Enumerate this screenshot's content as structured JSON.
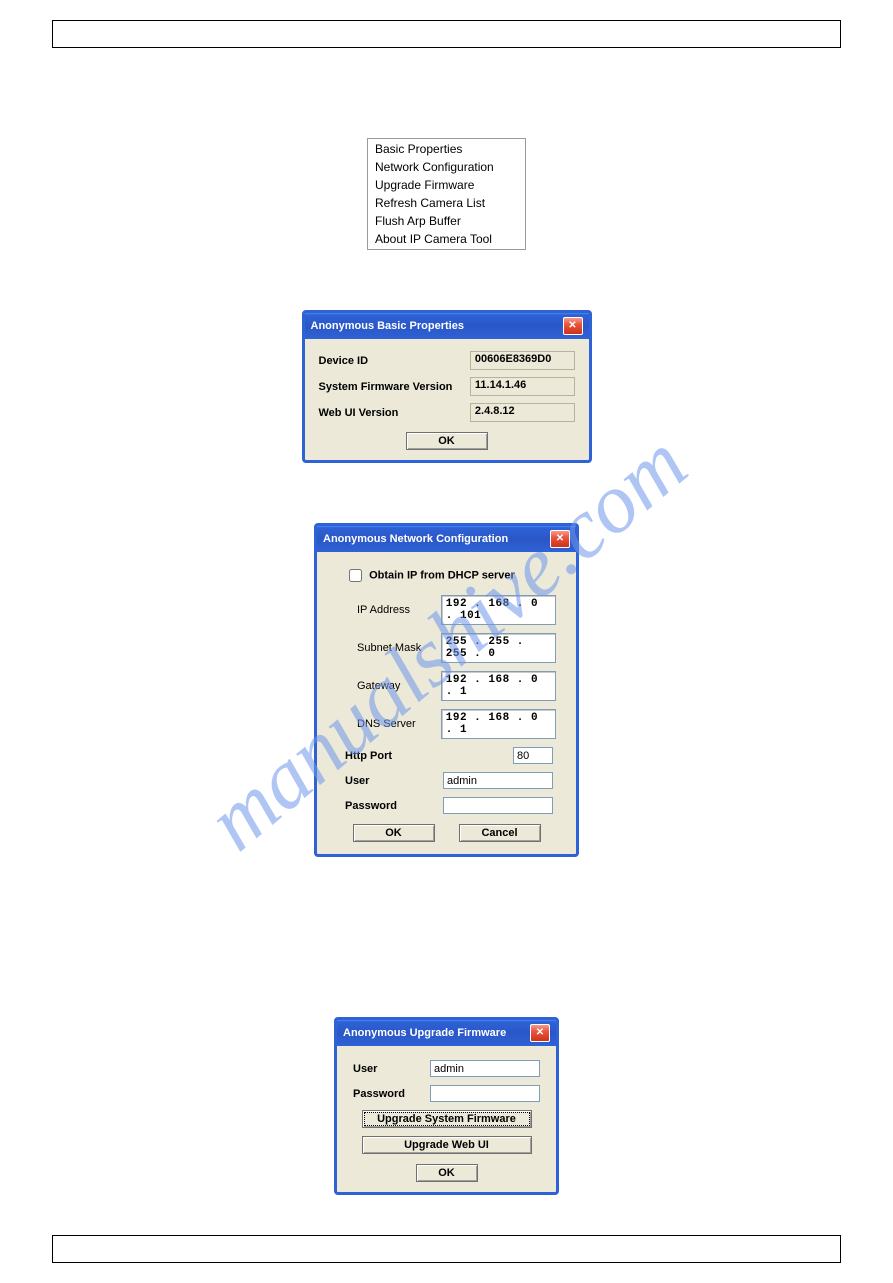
{
  "watermark": "manualshive.com",
  "context_menu": {
    "items": [
      "Basic Properties",
      "Network Configuration",
      "Upgrade Firmware",
      "Refresh Camera List",
      "Flush Arp Buffer",
      "About IP Camera Tool"
    ]
  },
  "dialog_basic": {
    "title": "Anonymous Basic Properties",
    "fields": {
      "device_id": {
        "label": "Device ID",
        "value": "00606E8369D0"
      },
      "firmware": {
        "label": "System Firmware Version",
        "value": "11.14.1.46"
      },
      "webui": {
        "label": "Web UI Version",
        "value": "2.4.8.12"
      }
    },
    "ok": "OK"
  },
  "dialog_network": {
    "title": "Anonymous Network Configuration",
    "dhcp_label": "Obtain IP from DHCP server",
    "dhcp_checked": false,
    "fields": {
      "ip": {
        "label": "IP Address",
        "value": "192 . 168 .  0  . 101"
      },
      "subnet": {
        "label": "Subnet Mask",
        "value": "255 . 255 . 255 .  0"
      },
      "gateway": {
        "label": "Gateway",
        "value": "192 . 168 .  0  .  1"
      },
      "dns": {
        "label": "DNS Server",
        "value": "192 . 168 .  0  .  1"
      }
    },
    "http_port": {
      "label": "Http Port",
      "value": "80"
    },
    "user": {
      "label": "User",
      "value": "admin"
    },
    "password": {
      "label": "Password",
      "value": ""
    },
    "ok": "OK",
    "cancel": "Cancel"
  },
  "dialog_upgrade": {
    "title": "Anonymous Upgrade Firmware",
    "user": {
      "label": "User",
      "value": "admin"
    },
    "password": {
      "label": "Password",
      "value": ""
    },
    "btn_sysfw": "Upgrade System Firmware",
    "btn_webui": "Upgrade Web UI",
    "ok": "OK"
  }
}
